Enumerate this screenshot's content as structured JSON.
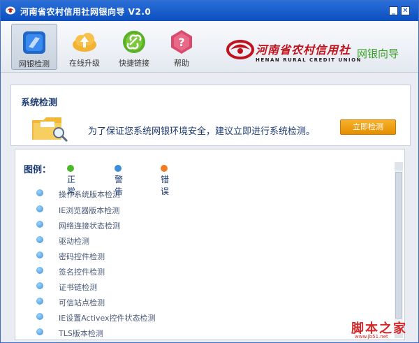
{
  "window": {
    "title": "河南省农村信用社网银向导 V2.0",
    "minimize_label": "_",
    "close_label": "✕"
  },
  "toolbar": {
    "items": [
      {
        "label": "网银检测",
        "icon": "monitor-icon",
        "active": true
      },
      {
        "label": "在线升级",
        "icon": "cloud-upload-icon",
        "active": false
      },
      {
        "label": "快捷链接",
        "icon": "link-icon",
        "active": false
      },
      {
        "label": "帮助",
        "icon": "help-icon",
        "active": false
      }
    ]
  },
  "bank": {
    "name_cn": "河南省农村信用社",
    "name_en": "HENAN RURAL CREDIT UNION",
    "subtitle": "网银向导"
  },
  "panel": {
    "title": "系统检测",
    "message": "为了保证您系统网银环境安全，建议立即进行系统检测。",
    "button_label": "立即检测"
  },
  "legend": {
    "title": "图例：",
    "normal": "正常",
    "warning": "警告",
    "error": "错误",
    "colors": {
      "normal": "#4cb82a",
      "warning": "#3a8fd8",
      "error": "#f07c24"
    }
  },
  "checks": [
    "操作系统版本检测",
    "IE浏览器版本检测",
    "网络连接状态检测",
    "驱动检测",
    "密码控件检测",
    "签名控件检测",
    "证书链检测",
    "可信站点检测",
    "IE设置Activex控件状态检测",
    "TLS版本检测"
  ],
  "watermark": {
    "text": "脚本之家",
    "url": "www.jb51.net"
  }
}
